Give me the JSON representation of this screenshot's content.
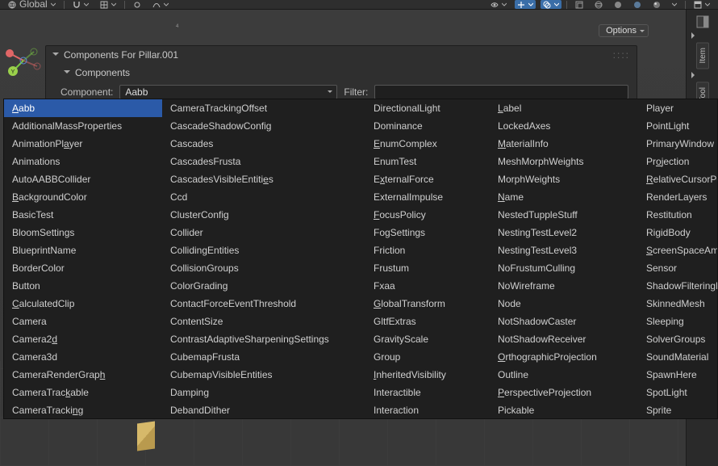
{
  "toolbar": {
    "coord_space": "Global",
    "options_label": "Options"
  },
  "right_dock": {
    "tabs": [
      "Item",
      "Tool"
    ]
  },
  "axis": {
    "marker": "4",
    "y_label": "Y"
  },
  "panel": {
    "header": "Components For Pillar.001",
    "sub_header": "Components",
    "component_label": "Component:",
    "component_value": "Aabb",
    "filter_label": "Filter:",
    "filter_value": ""
  },
  "dropdown": {
    "selected_index": 0,
    "columns": [
      [
        "Aabb",
        "AdditionalMassProperties",
        "AnimationPlayer",
        "Animations",
        "AutoAABBCollider",
        "BackgroundColor",
        "BasicTest",
        "BloomSettings",
        "BlueprintName",
        "BorderColor",
        "Button",
        "CalculatedClip",
        "Camera",
        "Camera2d",
        "Camera3d",
        "CameraRenderGraph",
        "CameraTrackable",
        "CameraTracking"
      ],
      [
        "CameraTrackingOffset",
        "CascadeShadowConfig",
        "Cascades",
        "CascadesFrusta",
        "CascadesVisibleEntities",
        "Ccd",
        "ClusterConfig",
        "Collider",
        "CollidingEntities",
        "CollisionGroups",
        "ColorGrading",
        "ContactForceEventThreshold",
        "ContentSize",
        "ContrastAdaptiveSharpeningSettings",
        "CubemapFrusta",
        "CubemapVisibleEntities",
        "Damping",
        "DebandDither"
      ],
      [
        "DirectionalLight",
        "Dominance",
        "EnumComplex",
        "EnumTest",
        "ExternalForce",
        "ExternalImpulse",
        "FocusPolicy",
        "FogSettings",
        "Friction",
        "Frustum",
        "Fxaa",
        "GlobalTransform",
        "GltfExtras",
        "GravityScale",
        "Group",
        "InheritedVisibility",
        "Interactible",
        "Interaction"
      ],
      [
        "Label",
        "LockedAxes",
        "MaterialInfo",
        "MeshMorphWeights",
        "MorphWeights",
        "Name",
        "NestedTuppleStuff",
        "NestingTestLevel2",
        "NestingTestLevel3",
        "NoFrustumCulling",
        "NoWireframe",
        "Node",
        "NotShadowCaster",
        "NotShadowReceiver",
        "OrthographicProjection",
        "Outline",
        "PerspectiveProjection",
        "Pickable"
      ],
      [
        "Player",
        "PointLight",
        "PrimaryWindow",
        "Projection",
        "RelativeCursorPos",
        "RenderLayers",
        "Restitution",
        "RigidBody",
        "ScreenSpaceAmbi",
        "Sensor",
        "ShadowFilteringM",
        "SkinnedMesh",
        "Sleeping",
        "SolverGroups",
        "SoundMaterial",
        "SpawnHere",
        "SpotLight",
        "Sprite"
      ]
    ],
    "underline_map": {
      "Aabb": 0,
      "BackgroundColor": 0,
      "CalculatedClip": 0,
      "Camera2d": 7,
      "CameraRenderGraph": 16,
      "CameraTrackable": 10,
      "CameraTracking": 12,
      "AnimationPlayer": 11,
      "CascadesVisibleEntities": 21,
      "EnumComplex": 0,
      "ExternalForce": 1,
      "FocusPolicy": 0,
      "GlobalTransform": 0,
      "InheritedVisibility": 0,
      "Label": 0,
      "MaterialInfo": 0,
      "Name": 0,
      "OrthographicProjection": 0,
      "PerspectiveProjection": 0,
      "Projection": 2,
      "RelativeCursorPos": 0,
      "ScreenSpaceAmbi": 0
    }
  }
}
